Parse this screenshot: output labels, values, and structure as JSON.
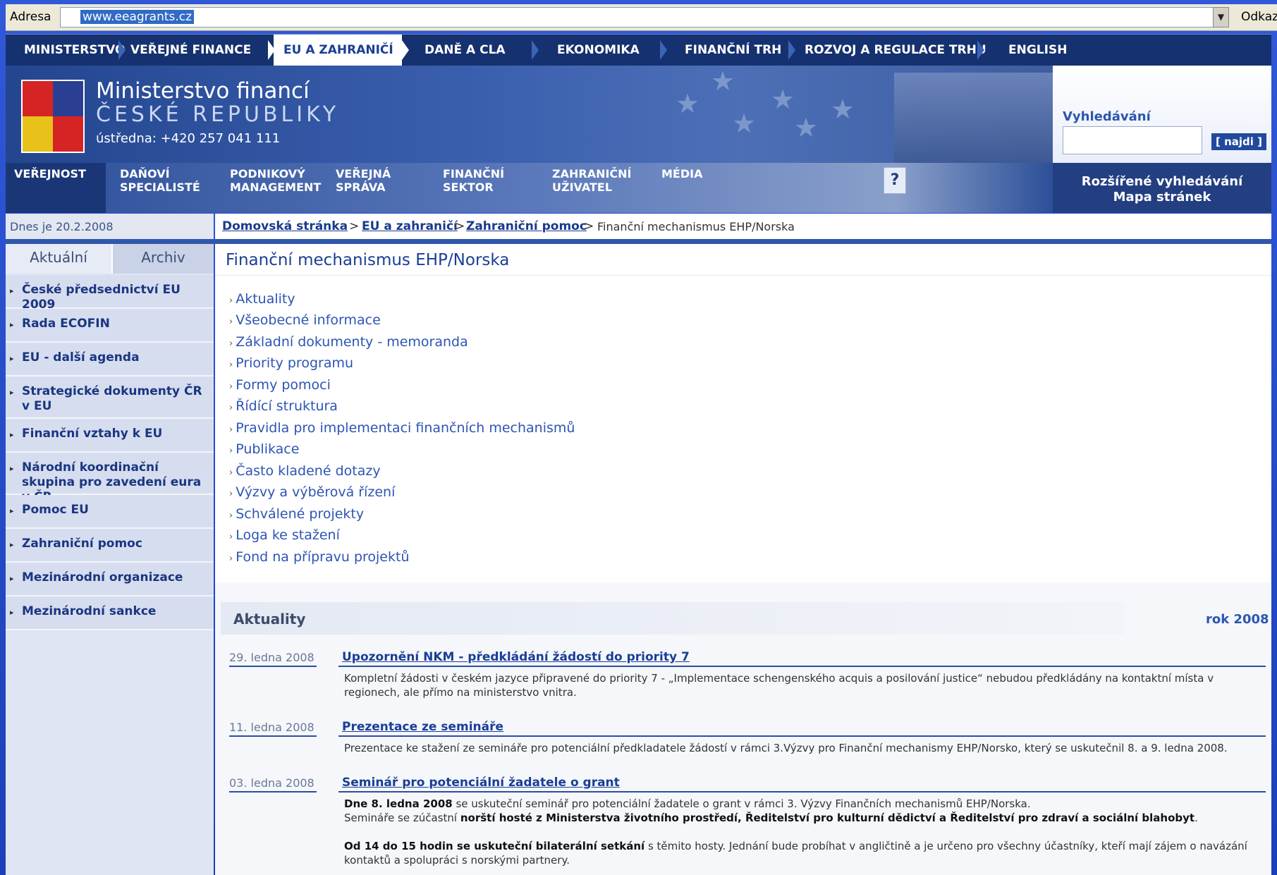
{
  "browser": {
    "address_label": "Adresa",
    "url": "www.eeagrants.cz",
    "links_label": "Odkazy"
  },
  "top_nav": {
    "items": [
      "MINISTERSTVO",
      "VEŘEJNÉ FINANCE",
      "EU A ZAHRANIČÍ",
      "DANĚ A CLA",
      "EKONOMIKA",
      "FINANČNÍ TRH",
      "ROZVOJ A REGULACE TRHU",
      "ENGLISH"
    ],
    "active": "EU A ZAHRANIČÍ"
  },
  "header": {
    "title_line1": "Ministerstvo financí",
    "title_line2": "ČESKÉ REPUBLIKY",
    "phone": "ústředna: +420 257 041 111"
  },
  "search": {
    "title": "Vyhledávání",
    "button": "[ najdi ]",
    "advanced": "Rozšířené vyhledávání",
    "sitemap": "Mapa stránek"
  },
  "audience_nav": {
    "items": [
      {
        "line1": "VEŘEJNOST",
        "line2": ""
      },
      {
        "line1": "DAŇOVÍ",
        "line2": "SPECIALISTÉ"
      },
      {
        "line1": "PODNIKOVÝ",
        "line2": "MANAGEMENT"
      },
      {
        "line1": "VEŘEJNÁ",
        "line2": "SPRÁVA"
      },
      {
        "line1": "FINANČNÍ",
        "line2": "SEKTOR"
      },
      {
        "line1": "ZAHRANIČNÍ",
        "line2": "UŽIVATEL"
      },
      {
        "line1": "MÉDIA",
        "line2": ""
      }
    ],
    "help": "?"
  },
  "date": "Dnes je 20.2.2008",
  "breadcrumb": {
    "home": "Domovská stránka",
    "sep": ">",
    "level1": "EU a zahraničí",
    "level2": "Zahraniční pomoc",
    "current": "Finanční mechanismus EHP/Norska"
  },
  "sidebar": {
    "tabs": [
      "Aktuální",
      "Archiv"
    ],
    "items": [
      "České předsednictví EU 2009",
      "Rada ECOFIN",
      "EU - další agenda",
      "Strategické dokumenty ČR v EU",
      "Finanční vztahy k EU",
      "Národní koordinační skupina pro zavedení eura v ČR",
      "Pomoc EU",
      "Zahraniční pomoc",
      "Mezinárodní organizace",
      "Mezinárodní sankce"
    ]
  },
  "main": {
    "title": "Finanční mechanismus EHP/Norska",
    "links": [
      "Aktuality",
      "Všeobecné informace",
      "Základní dokumenty - memoranda",
      "Priority programu",
      "Formy pomoci",
      "Řídící struktura",
      "Pravidla pro implementaci finančních mechanismů",
      "Publikace",
      "Často kladené dotazy",
      "Výzvy a výběrová řízení",
      "Schválené projekty",
      "Loga ke stažení",
      "Fond na přípravu projektů"
    ]
  },
  "news": {
    "title": "Aktuality",
    "year": "rok 2008",
    "items": [
      {
        "date": "29. ledna 2008",
        "headline": "Upozornění NKM - předkládání žádostí do priority 7",
        "body": "Kompletní žádosti v českém jazyce připravené do priority 7 - „Implementace schengenského acquis a posilování justice“ nebudou předkládány na kontaktní místa v regionech, ale přímo na ministerstvo vnitra."
      },
      {
        "date": "11. ledna 2008",
        "headline": "Prezentace ze semináře",
        "body": "Prezentace ke stažení ze semináře pro potenciální předkladatele žádostí v rámci 3.Výzvy pro Finanční mechanismy EHP/Norsko, který se uskutečnil 8. a 9. ledna 2008."
      },
      {
        "date": "03. ledna 2008",
        "headline": "Seminář pro potenciální žadatele o grant",
        "body_p1_bold": "Dne 8. ledna 2008",
        "body_p1": " se uskuteční seminář pro potenciální žadatele o grant v rámci 3. Výzvy Finančních mechanismů EHP/Norska.",
        "body_p2": "Semináře se zúčastní ",
        "body_p2_bold": "norští hosté z Ministerstva životního prostředí, Ředitelství pro kulturní dědictví a Ředitelství pro zdraví a sociální blahobyt",
        "body_p2_end": ".",
        "body_p3_bold": "Od 14 do 15 hodin se uskuteční bilaterální setkání",
        "body_p3": " s těmito hosty. Jednání bude probíhat v angličtině a je určeno pro všechny účastníky, kteří mají zájem o navázání kontaktů a spolupráci s norskými partnery."
      }
    ]
  }
}
